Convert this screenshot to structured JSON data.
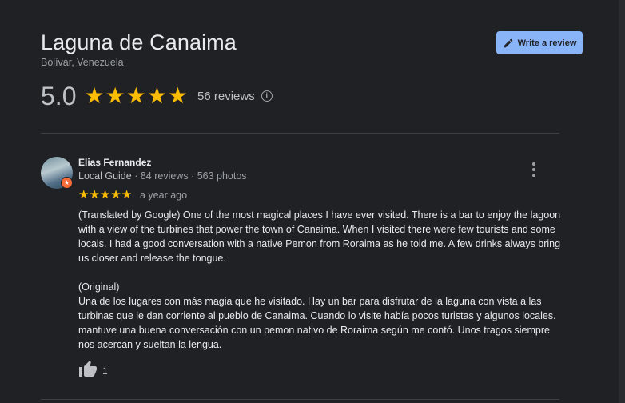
{
  "place": {
    "title": "Laguna de Canaima",
    "location": "Bolívar, Venezuela",
    "rating": "5.0",
    "rating_value": 5,
    "reviews_label": "56 reviews",
    "write_review_label": "Write a review"
  },
  "review": {
    "author": "Elias Fernandez",
    "guide_label": "Local Guide",
    "stats": "· 84 reviews · 563 photos",
    "stars": 5,
    "time": "a year ago",
    "translated": "(Translated by Google) One of the most magical places I have ever visited. There is a bar to enjoy the lagoon with a view of the turbines that power the town of Canaima. When I visited there were few tourists and some locals. I had a good conversation with a native Pemon from Roraima as he told me. A few drinks always bring us closer and release the tongue.",
    "original_label": "(Original)",
    "original": "Una de los lugares con más magia que he visitado. Hay un bar para disfrutar de la laguna con vista a las turbinas que le dan corriente al pueblo de Canaima. Cuando lo visite había pocos turistas y algunos locales. mantuve una buena conversación con un pemon nativo de Roraima según me contó. Unos tragos siempre nos acercan y sueltan la lengua.",
    "likes": "1"
  },
  "colors": {
    "background": "#202124",
    "star": "#fbbc04",
    "accent": "#8ab4f8",
    "guide_badge": "#f76b39"
  },
  "icons": {
    "star": "star-icon",
    "info": "info-icon",
    "edit": "pencil-icon",
    "more": "more-vertical-icon",
    "like": "thumbs-up-icon"
  }
}
